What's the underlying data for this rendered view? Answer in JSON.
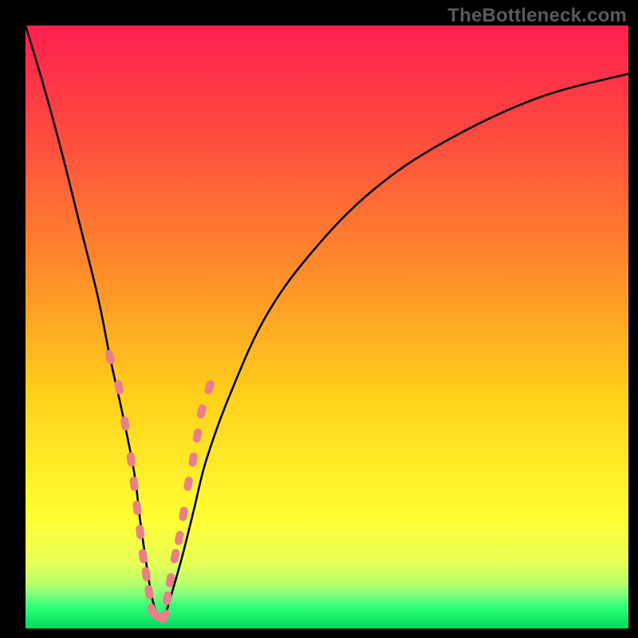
{
  "watermark": "TheBottleneck.com",
  "chart_data": {
    "type": "line",
    "title": "",
    "xlabel": "",
    "ylabel": "",
    "xlim": [
      0,
      100
    ],
    "ylim": [
      0,
      100
    ],
    "grid": false,
    "legend": false,
    "description": "Bottleneck heat gradient. X roughly maps to relative component strength, Y is bottleneck severity (0 = perfect match at the valley, 100 = worst). Background is a vertical severity heat map (red→orange→yellow→green). Single black V-shaped curve with its minimum near x≈22. Pink pill-shaped markers cluster along the flanks of the valley.",
    "gradient_stops": [
      {
        "pct": 0,
        "color": "#ff1f4f"
      },
      {
        "pct": 18,
        "color": "#ff4a3f"
      },
      {
        "pct": 40,
        "color": "#ff8a2a"
      },
      {
        "pct": 62,
        "color": "#ffd21a"
      },
      {
        "pct": 82,
        "color": "#ffff33"
      },
      {
        "pct": 89,
        "color": "#e8ff55"
      },
      {
        "pct": 92.5,
        "color": "#b7ff6a"
      },
      {
        "pct": 94.5,
        "color": "#7dff7a"
      },
      {
        "pct": 96.5,
        "color": "#2dff77"
      },
      {
        "pct": 100,
        "color": "#04d85c"
      }
    ],
    "series": [
      {
        "name": "bottleneck-curve",
        "x": [
          0,
          3,
          6,
          9,
          12,
          14,
          16,
          18,
          19,
          20,
          21,
          22,
          23,
          24,
          26,
          28,
          30,
          34,
          40,
          48,
          58,
          70,
          85,
          100
        ],
        "values": [
          100,
          90,
          79,
          67,
          55,
          45,
          36,
          26,
          18,
          11,
          5,
          2,
          2,
          5,
          12,
          20,
          28,
          39,
          52,
          63,
          73,
          81,
          88,
          92
        ]
      }
    ],
    "markers": {
      "name": "highlighted-points",
      "shape": "pill",
      "color": "#ec7e8b",
      "points": [
        {
          "x": 14.0,
          "y": 45
        },
        {
          "x": 15.5,
          "y": 40
        },
        {
          "x": 16.5,
          "y": 34
        },
        {
          "x": 17.5,
          "y": 28
        },
        {
          "x": 18.0,
          "y": 24
        },
        {
          "x": 18.5,
          "y": 20
        },
        {
          "x": 19.0,
          "y": 16
        },
        {
          "x": 19.5,
          "y": 12
        },
        {
          "x": 20.0,
          "y": 9
        },
        {
          "x": 20.5,
          "y": 6
        },
        {
          "x": 21.0,
          "y": 3
        },
        {
          "x": 22.0,
          "y": 2
        },
        {
          "x": 23.0,
          "y": 2
        },
        {
          "x": 23.5,
          "y": 5
        },
        {
          "x": 24.0,
          "y": 8
        },
        {
          "x": 24.8,
          "y": 12
        },
        {
          "x": 25.5,
          "y": 15
        },
        {
          "x": 26.2,
          "y": 19
        },
        {
          "x": 27.0,
          "y": 24
        },
        {
          "x": 27.8,
          "y": 28
        },
        {
          "x": 28.5,
          "y": 32
        },
        {
          "x": 29.2,
          "y": 36
        },
        {
          "x": 30.5,
          "y": 40
        }
      ]
    }
  }
}
